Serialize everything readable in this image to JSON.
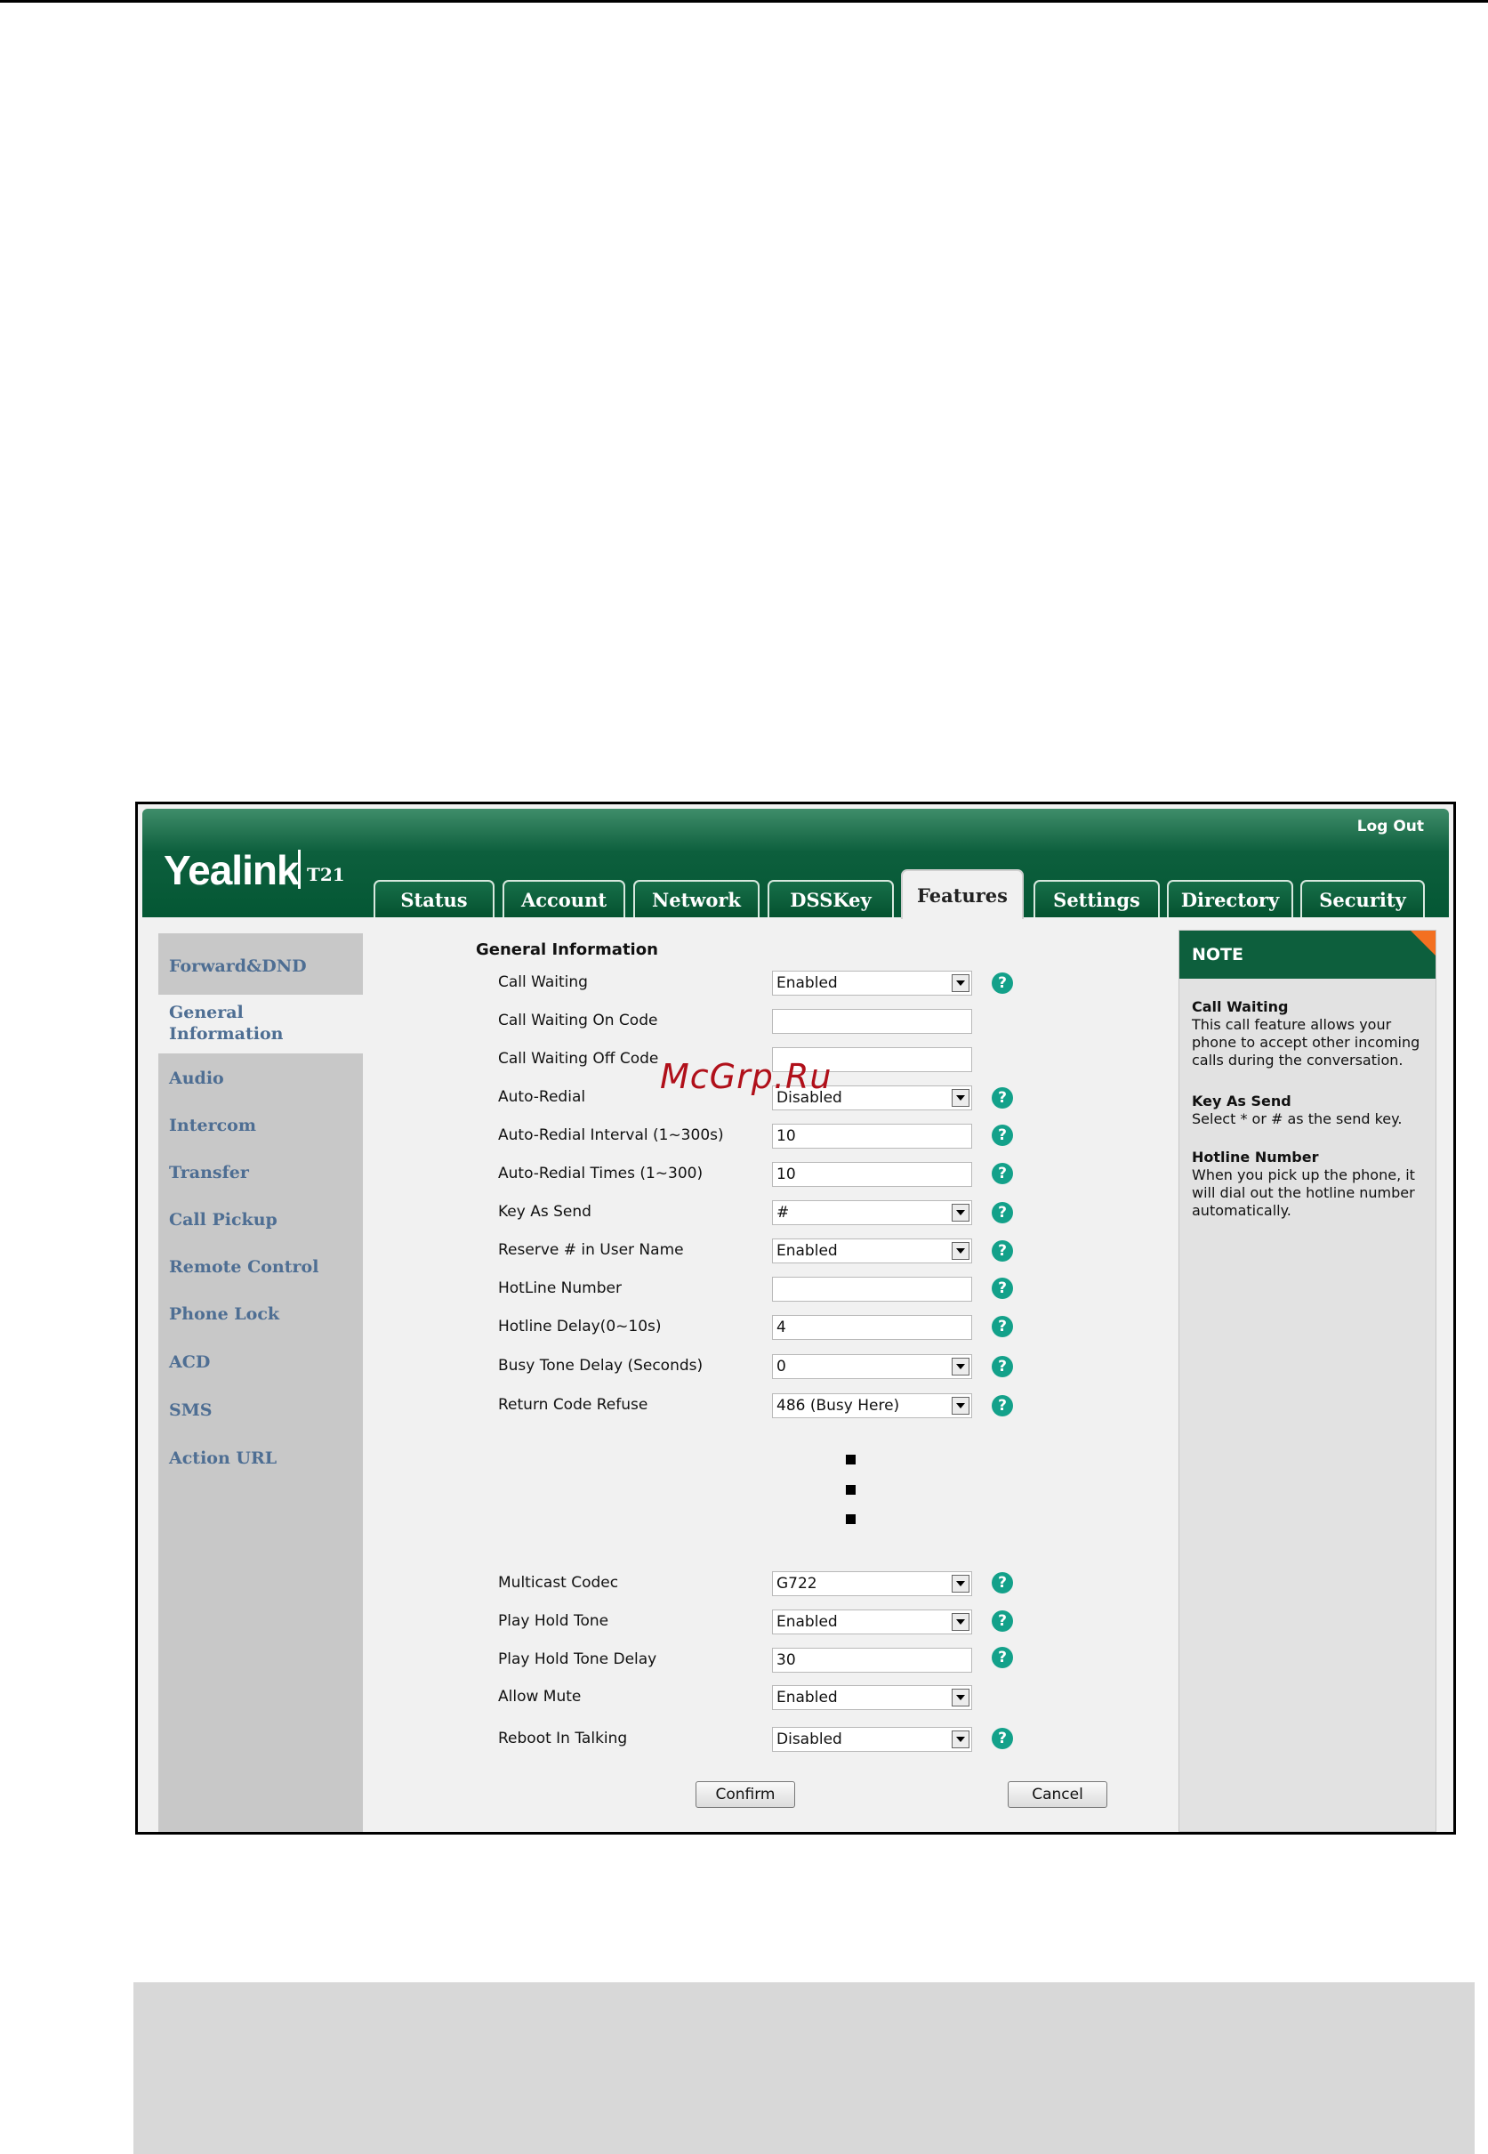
{
  "header": {
    "brand": "Yealink",
    "model": "T21",
    "logout": "Log Out"
  },
  "tabs": [
    {
      "label": "Status"
    },
    {
      "label": "Account"
    },
    {
      "label": "Network"
    },
    {
      "label": "DSSKey"
    },
    {
      "label": "Features",
      "active": true
    },
    {
      "label": "Settings"
    },
    {
      "label": "Directory"
    },
    {
      "label": "Security"
    }
  ],
  "sidebar": {
    "items": [
      {
        "label": "Forward&DND"
      },
      {
        "label": "General Information",
        "active": true
      },
      {
        "label": "Audio"
      },
      {
        "label": "Intercom"
      },
      {
        "label": "Transfer"
      },
      {
        "label": "Call Pickup"
      },
      {
        "label": "Remote Control"
      },
      {
        "label": "Phone Lock"
      },
      {
        "label": "ACD"
      },
      {
        "label": "SMS"
      },
      {
        "label": "Action URL"
      }
    ]
  },
  "main": {
    "section_title": "General Information",
    "rows": [
      {
        "label": "Call Waiting",
        "value": "Enabled",
        "type": "select",
        "help": true
      },
      {
        "label": "Call Waiting On Code",
        "value": "",
        "type": "text",
        "help": false
      },
      {
        "label": "Call Waiting Off Code",
        "value": "",
        "type": "text",
        "help": false
      },
      {
        "label": "Auto-Redial",
        "value": "Disabled",
        "type": "select",
        "help": true
      },
      {
        "label": "Auto-Redial Interval (1~300s)",
        "value": "10",
        "type": "text",
        "help": true
      },
      {
        "label": "Auto-Redial Times (1~300)",
        "value": "10",
        "type": "text",
        "help": true
      },
      {
        "label": "Key As Send",
        "value": "#",
        "type": "select",
        "help": true
      },
      {
        "label": "Reserve # in User Name",
        "value": "Enabled",
        "type": "select",
        "help": true
      },
      {
        "label": "HotLine Number",
        "value": "",
        "type": "text",
        "help": true
      },
      {
        "label": "Hotline Delay(0~10s)",
        "value": "4",
        "type": "text",
        "help": true
      },
      {
        "label": "Busy Tone Delay (Seconds)",
        "value": "0",
        "type": "select",
        "help": true
      },
      {
        "label": "Return Code Refuse",
        "value": "486 (Busy Here)",
        "type": "select",
        "help": true
      },
      {
        "label": "Multicast Codec",
        "value": "G722",
        "type": "select",
        "help": true
      },
      {
        "label": "Play Hold Tone",
        "value": "Enabled",
        "type": "select",
        "help": true
      },
      {
        "label": "Play Hold Tone Delay",
        "value": "30",
        "type": "text",
        "help": true
      },
      {
        "label": "Allow Mute",
        "value": "Enabled",
        "type": "select",
        "help": false
      },
      {
        "label": "Reboot In Talking",
        "value": "Disabled",
        "type": "select",
        "help": true
      }
    ],
    "confirm": "Confirm",
    "cancel": "Cancel",
    "help_glyph": "?"
  },
  "note": {
    "heading": "NOTE",
    "items": [
      {
        "title": "Call Waiting",
        "text": "This call feature allows your phone to accept other incoming calls during the conversation."
      },
      {
        "title": "Key As Send",
        "text": "Select * or # as the send key."
      },
      {
        "title": "Hotline Number",
        "text": "When you pick up the phone, it will dial out the hotline number automatically."
      }
    ]
  },
  "watermark": "McGrp.Ru",
  "colors": {
    "header_green": "#0d5f3d",
    "link_blue": "#4e6e93",
    "help_teal": "#13a18a",
    "note_corner": "#f37021"
  }
}
